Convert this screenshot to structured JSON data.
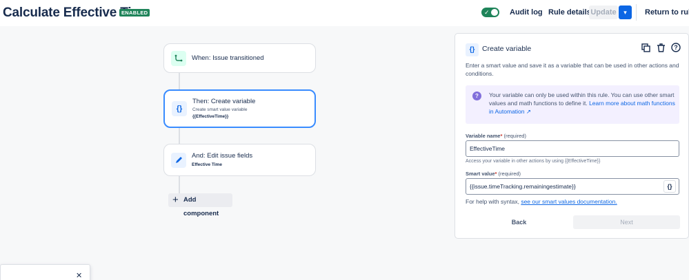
{
  "header": {
    "title": "Calculate Effective Time",
    "badge": "ENABLED",
    "audit_log": "Audit log",
    "rule_details": "Rule details",
    "update": "Update",
    "return": "Return to rules",
    "toggle_on": true
  },
  "flow": {
    "trigger": {
      "title": "When: Issue transitioned",
      "icon": "transition-icon"
    },
    "action1": {
      "title": "Then: Create variable",
      "sub": "Create smart value variable",
      "var": "{{EffectiveTime}}",
      "icon": "curly-braces-icon"
    },
    "action2": {
      "title": "And: Edit issue fields",
      "field": "Effective Time",
      "icon": "pencil-icon"
    },
    "add_component": "Add component"
  },
  "panel": {
    "title": "Create variable",
    "description": "Enter a smart value and save it as a variable that can be used in other actions and conditions.",
    "info_text": "Your variable can only be used within this rule. You can use other smart values and math functions to define it.",
    "info_link": "Learn more about math functions in Automation ↗",
    "var_name_label": "Variable name",
    "var_name_value": "EffectiveTime",
    "var_name_hint": "Access your variable in other actions by using {{EffectiveTime}}",
    "smart_value_label": "Smart value",
    "smart_value_value": "{{issue.timeTracking.remainingestimate}}",
    "required_marker": "*",
    "required_text": "(required)",
    "help_text": "For help with syntax,",
    "help_link": "see our smart values documentation.",
    "back": "Back",
    "next": "Next"
  },
  "colors": {
    "accent": "#0c66e4",
    "enabled": "#1f845a",
    "info_bg": "#f3f0ff"
  }
}
